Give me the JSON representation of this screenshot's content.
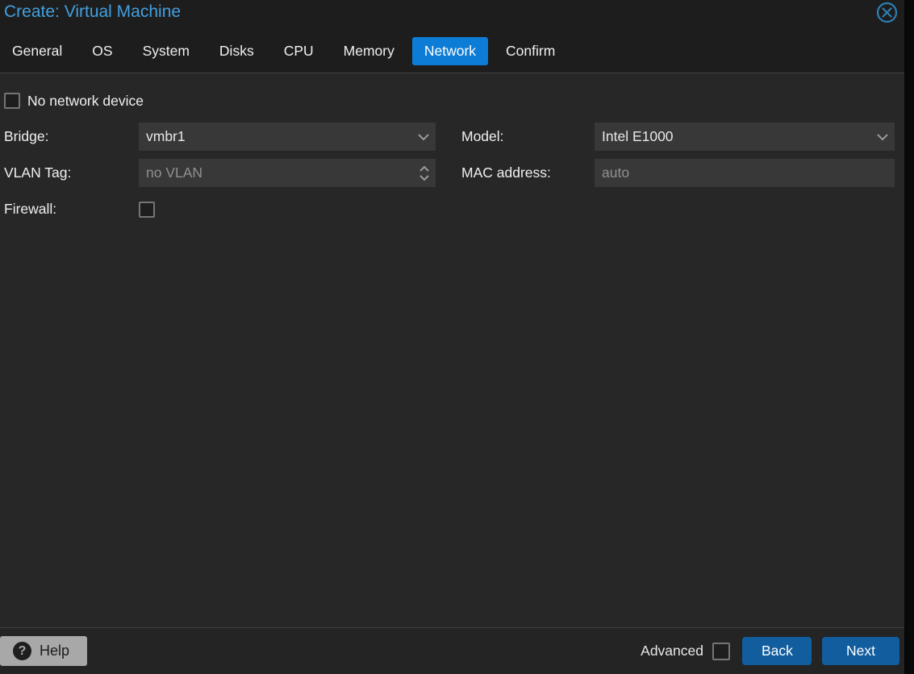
{
  "window": {
    "title": "Create: Virtual Machine"
  },
  "tabs": [
    {
      "label": "General",
      "active": false
    },
    {
      "label": "OS",
      "active": false
    },
    {
      "label": "System",
      "active": false
    },
    {
      "label": "Disks",
      "active": false
    },
    {
      "label": "CPU",
      "active": false
    },
    {
      "label": "Memory",
      "active": false
    },
    {
      "label": "Network",
      "active": true
    },
    {
      "label": "Confirm",
      "active": false
    }
  ],
  "form": {
    "no_network_device": {
      "label": "No network device",
      "checked": false
    },
    "bridge": {
      "label": "Bridge:",
      "value": "vmbr1",
      "control": "dropdown"
    },
    "vlan_tag": {
      "label": "VLAN Tag:",
      "value": "",
      "placeholder": "no VLAN",
      "control": "number-spinner"
    },
    "firewall": {
      "label": "Firewall:",
      "checked": false
    },
    "model": {
      "label": "Model:",
      "value": "Intel E1000",
      "control": "dropdown"
    },
    "mac_address": {
      "label": "MAC address:",
      "value": "",
      "placeholder": "auto",
      "control": "text"
    }
  },
  "footer": {
    "help": "Help",
    "advanced": "Advanced",
    "advanced_checked": false,
    "back": "Back",
    "next": "Next"
  },
  "colors": {
    "active_tab_blue": "#0d7cd6",
    "button_blue": "#115d9e",
    "title_blue": "#42a0df",
    "close_icon_blue": "#2d7fb3",
    "body_bg": "#272727",
    "header_bg": "#1d1d1d",
    "field_bg": "#383838",
    "placeholder_gray": "#909090"
  }
}
